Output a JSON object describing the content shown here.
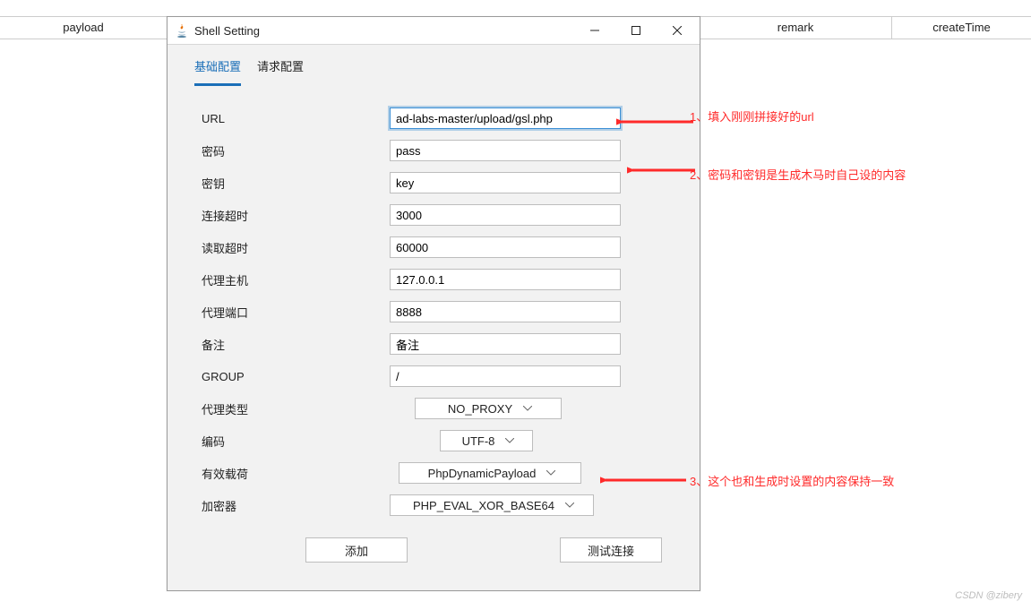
{
  "bgColumns": {
    "c1": "payload",
    "c2": "remark",
    "c3": "createTime"
  },
  "window": {
    "title": "Shell Setting",
    "tabs": {
      "basic": "基础配置",
      "request": "请求配置"
    },
    "labels": {
      "url": "URL",
      "password": "密码",
      "secret": "密钥",
      "connTimeout": "连接超时",
      "readTimeout": "读取超时",
      "proxyHost": "代理主机",
      "proxyPort": "代理端口",
      "remark": "备注",
      "group": "GROUP",
      "proxyType": "代理类型",
      "encoding": "编码",
      "payload": "有效载荷",
      "encryptor": "加密器"
    },
    "values": {
      "url": "ad-labs-master/upload/gsl.php",
      "password": "pass",
      "secret": "key",
      "connTimeout": "3000",
      "readTimeout": "60000",
      "proxyHost": "127.0.0.1",
      "proxyPort": "8888",
      "remark": "备注",
      "group": "/",
      "proxyType": "NO_PROXY",
      "encoding": "UTF-8",
      "payload": "PhpDynamicPayload",
      "encryptor": "PHP_EVAL_XOR_BASE64"
    },
    "buttons": {
      "add": "添加",
      "test": "测试连接"
    }
  },
  "annotations": {
    "a1": "1、填入刚刚拼接好的url",
    "a2": "2、密码和密钥是生成木马时自己设的内容",
    "a3": "3、这个也和生成时设置的内容保持一致"
  },
  "watermark": "CSDN @zibery"
}
